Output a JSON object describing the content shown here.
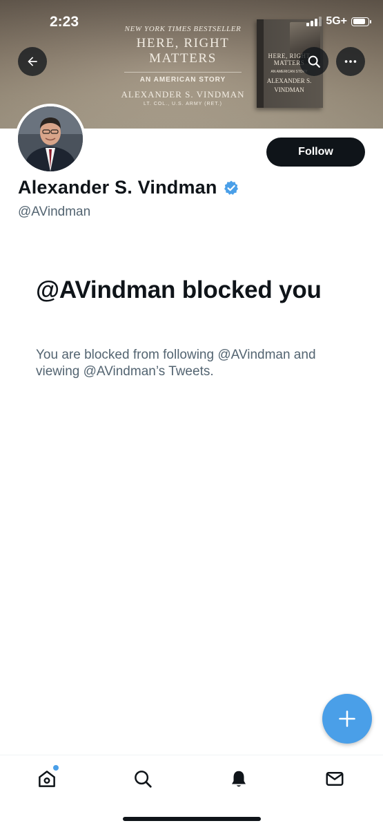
{
  "status_bar": {
    "time": "2:23",
    "network": "5G+"
  },
  "banner": {
    "bestseller": "NEW YORK TIMES BESTSELLER",
    "book_title_line1": "HERE, RIGHT",
    "book_title_line2": "MATTERS",
    "subtitle": "AN AMERICAN STORY",
    "author": "ALEXANDER S. VINDMAN",
    "rank": "LT. COL., U.S. ARMY (RET.)",
    "cover": {
      "title_line1": "HERE, RIGHT",
      "title_line2": "MATTERS",
      "subtitle": "AN AMERICAN STORY",
      "author_line1": "ALEXANDER S.",
      "author_line2": "VINDMAN"
    }
  },
  "icons": {
    "back": "back-arrow-icon",
    "search": "search-icon",
    "more": "more-icon",
    "verified": "verified-badge-icon",
    "compose": "plus-icon",
    "home": "home-icon",
    "explore": "search-icon",
    "notifications": "bell-icon",
    "messages": "mail-icon"
  },
  "profile": {
    "name": "Alexander S. Vindman",
    "handle": "@AVindman",
    "follow_label": "Follow"
  },
  "blocked": {
    "title": "@AVindman blocked you",
    "description": "You are blocked from following @AVindman and viewing @AVindman’s Tweets."
  },
  "colors": {
    "accent": "#4a9fe8",
    "text_primary": "#0f1419",
    "text_secondary": "#536471",
    "verified": "#4a9fe8"
  }
}
